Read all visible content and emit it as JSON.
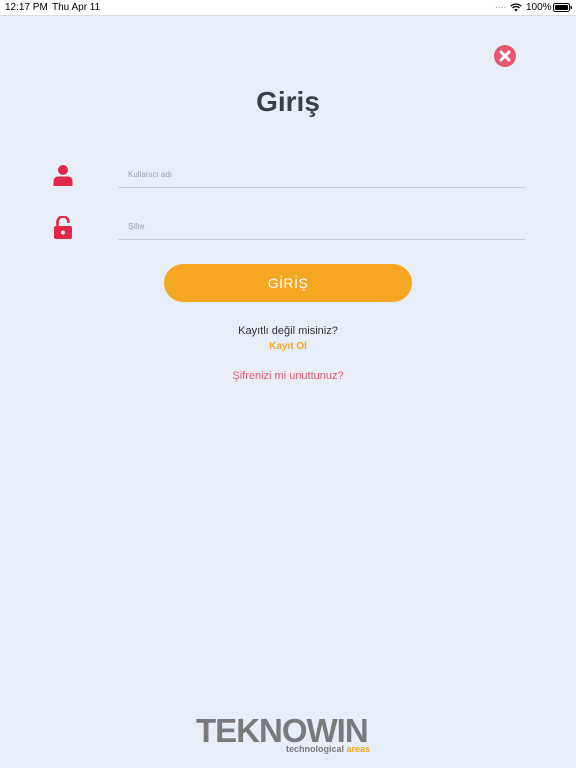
{
  "status_bar": {
    "time": "12:17 PM",
    "date": "Thu Apr 11",
    "dots": "....",
    "battery_percent": "100%"
  },
  "icons": {
    "close": "close-icon",
    "user": "user-icon",
    "lock": "unlock-icon",
    "wifi": "wifi-icon",
    "battery": "battery-icon"
  },
  "title": "Giriş",
  "form": {
    "username_placeholder": "Kullanıcı adı",
    "username_value": "",
    "password_placeholder": "Şifre",
    "password_value": ""
  },
  "login_button": "GİRİŞ",
  "register": {
    "question": "Kayıtlı değil misiniz?",
    "link": "Kayıt Ol"
  },
  "forgot_password": "Şifrenizi mi unuttunuz?",
  "logo": {
    "name": "TEKNOWIN",
    "tagline_part1": "technological",
    "tagline_part2": "areas"
  },
  "colors": {
    "background": "#e8eef8",
    "accent": "#f5a623",
    "danger": "#e5566f",
    "text": "#3a3f45"
  }
}
